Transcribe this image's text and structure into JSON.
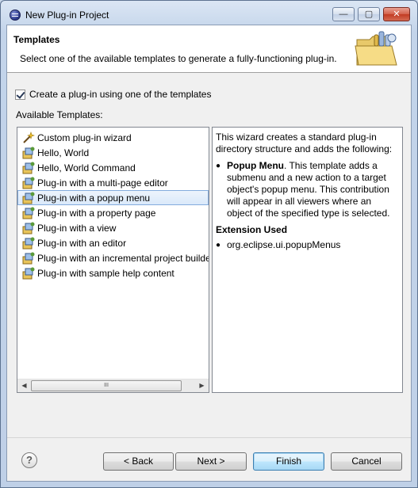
{
  "window": {
    "title": "New Plug-in Project",
    "controls": {
      "minimize": "—",
      "maximize": "▢",
      "close": "✕"
    }
  },
  "banner": {
    "title": "Templates",
    "description": "Select one of the available templates to generate a fully-functioning plug-in.",
    "image": "folder-wizard-icon"
  },
  "options": {
    "use_template_label": "Create a plug-in using one of the templates",
    "use_template_checked": true
  },
  "templates": {
    "label": "Available Templates:",
    "items": [
      {
        "label": "Custom plug-in wizard",
        "icon": "custom-wizard-icon"
      },
      {
        "label": "Hello, World",
        "icon": "template-icon"
      },
      {
        "label": "Hello, World Command",
        "icon": "template-icon"
      },
      {
        "label": "Plug-in with a multi-page editor",
        "icon": "template-icon"
      },
      {
        "label": "Plug-in with a popup menu",
        "icon": "template-icon"
      },
      {
        "label": "Plug-in with a property page",
        "icon": "template-icon"
      },
      {
        "label": "Plug-in with a view",
        "icon": "template-icon"
      },
      {
        "label": "Plug-in with an editor",
        "icon": "template-icon"
      },
      {
        "label": "Plug-in with an incremental project builder",
        "icon": "template-icon"
      },
      {
        "label": "Plug-in with sample help content",
        "icon": "template-icon"
      }
    ],
    "selected_index": 4,
    "scroll": {
      "left": "◀",
      "right": "▶",
      "grip": "III"
    }
  },
  "description": {
    "intro": "This wizard creates a standard plug-in directory structure and adds the following:",
    "bullet_title": "Popup Menu",
    "bullet_text": ". This template adds a submenu and a new action to a target object's popup menu. This contribution will appear in all viewers where an object of the specified type is selected.",
    "extension_heading": "Extension Used",
    "extension_item": "org.eclipse.ui.popupMenus",
    "bullet_char": "●"
  },
  "footer": {
    "help": "?",
    "back_label": "< Back",
    "next_label": "Next >",
    "finish_label": "Finish",
    "cancel_label": "Cancel"
  }
}
